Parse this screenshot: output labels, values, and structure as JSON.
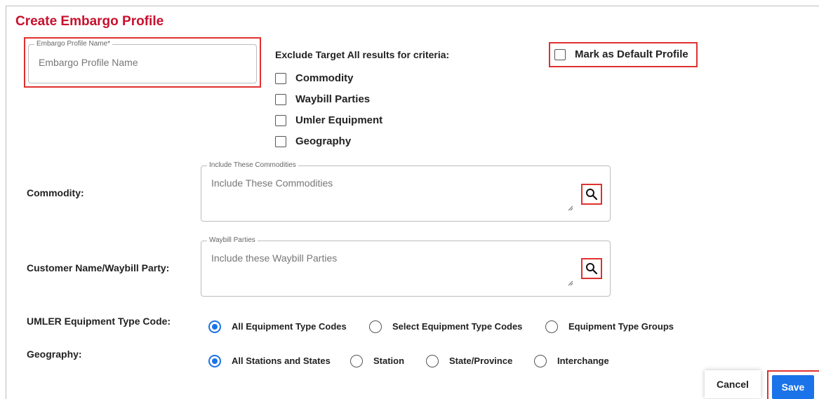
{
  "page_title": "Create Embargo Profile",
  "profile_name": {
    "legend": "Embargo Profile Name*",
    "placeholder": "Embargo Profile Name",
    "value": ""
  },
  "exclude": {
    "heading": "Exclude Target All results for criteria:",
    "options": [
      {
        "label": "Commodity",
        "checked": false
      },
      {
        "label": "Waybill Parties",
        "checked": false
      },
      {
        "label": "Umler Equipment",
        "checked": false
      },
      {
        "label": "Geography",
        "checked": false
      }
    ]
  },
  "default_profile": {
    "label": "Mark as Default Profile",
    "checked": false
  },
  "commodity": {
    "label": "Commodity:",
    "legend": "Include These Commodities",
    "placeholder": "Include These Commodities"
  },
  "waybill": {
    "label": "Customer Name/Waybill Party:",
    "legend": "Waybill Parties",
    "placeholder": "Include these Waybill Parties"
  },
  "umler": {
    "label": "UMLER Equipment Type Code:",
    "options": [
      "All Equipment Type Codes",
      "Select Equipment Type Codes",
      "Equipment Type Groups"
    ],
    "selected": "All Equipment Type Codes"
  },
  "geography": {
    "label": "Geography:",
    "options": [
      "All Stations and States",
      "Station",
      "State/Province",
      "Interchange"
    ],
    "selected": "All Stations and States"
  },
  "actions": {
    "cancel": "Cancel",
    "save": "Save"
  },
  "icons": {
    "search": "search-icon",
    "resize": "resize-handle-icon"
  },
  "colors": {
    "title": "#c8102e",
    "highlight": "#e0312f",
    "primary": "#1a73e8"
  }
}
